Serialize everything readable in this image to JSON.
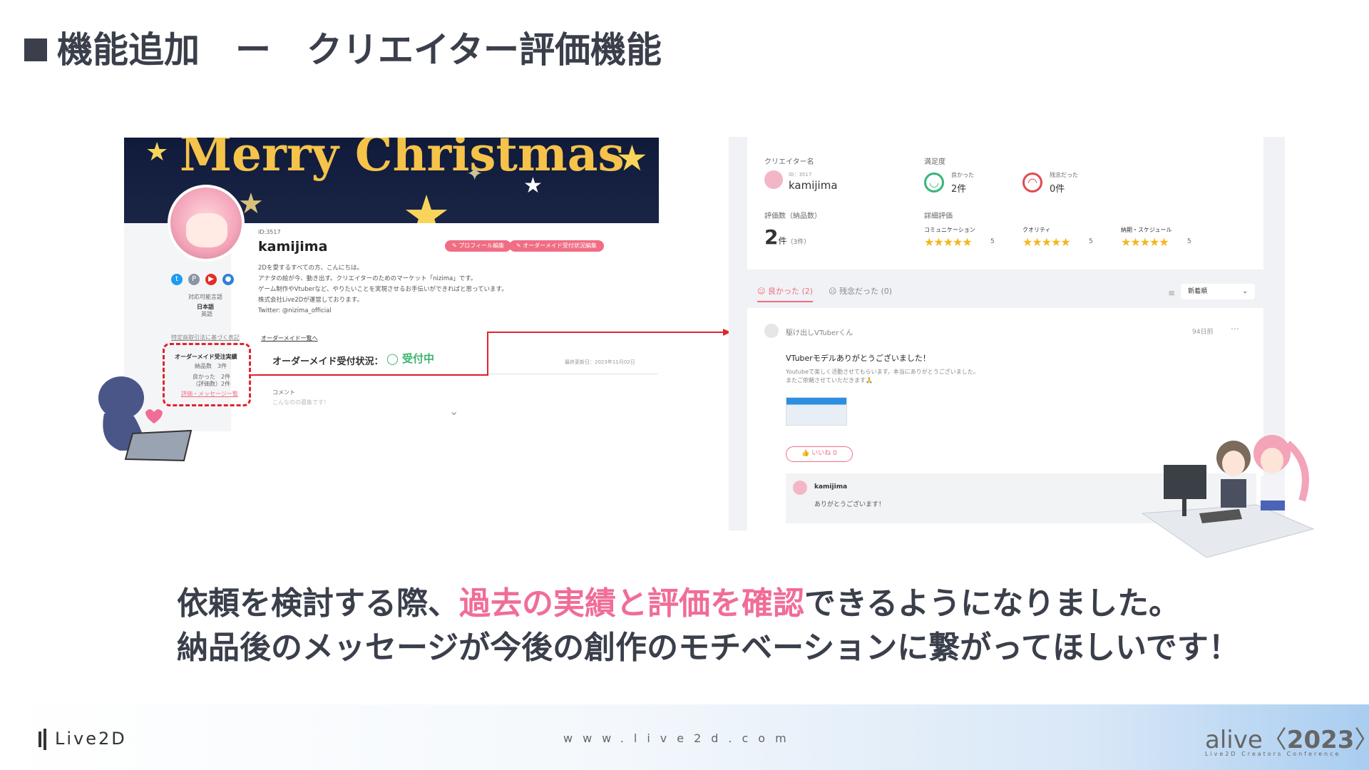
{
  "slide": {
    "title": "機能追加　ー　クリエイター評価機能",
    "subtitle_line1_a": "依頼を検討する際、",
    "subtitle_line1_highlight": "過去の実績と評価を確認",
    "subtitle_line1_b": "できるようになりました。",
    "subtitle_line2": "納品後のメッセージが今後の創作のモチベーションに繋がってほしいです！",
    "highlight_color": "#f06d97"
  },
  "left_screen": {
    "banner_text": "Merry Christmas",
    "creator_id": "ID:3517",
    "creator_name": "kamijima",
    "profile_edit_button": "プロフィール編集",
    "order_settings_button": "オーダーメイド受付状況編集",
    "bio_lines": [
      "2Dを愛するすべての方、こんにちは。",
      "アナタの絵が今、動き出す。クリエイターのためのマーケット「nizima」です。",
      "ゲーム制作やVtuberなど、やりたいことを実現させるお手伝いができればと思っています。",
      "株式会社Live2Dが運営しております。",
      "Twitter: @nizima_official"
    ],
    "languages_label": "対応可能言語",
    "languages": [
      "日本語",
      "英語"
    ],
    "legal_link": "特定商取引法に基づく表記",
    "order_list_link": "オーダーメイド一覧へ",
    "stats_title": "オーダーメイド受注実績",
    "stats_delivered": "納品数　3件",
    "stats_good": "良かった　2件",
    "stats_rated": "（評価数）2件",
    "stats_link": "評価・メッセージ一覧",
    "order_status_label": "オーダーメイド受付状況：",
    "order_status_value": "受付中",
    "last_updated": "最終更新日：2023年11月02日",
    "comment_label": "コメント",
    "comment_placeholder": "こんなのの募集です！"
  },
  "right_screen": {
    "creator_label": "クリエイター名",
    "creator_id": "ID：3517",
    "creator_name": "kamijima",
    "satisfaction_label": "満足度",
    "good_label": "良かった",
    "good_count": "2件",
    "bad_label": "残念だった",
    "bad_count": "0件",
    "rating_count_label": "評価数（納品数）",
    "rating_count": "2",
    "rating_unit": "件",
    "delivered_note": "（3件）",
    "detail_label": "詳細評価",
    "detail_items": [
      {
        "label": "コミュニケーション",
        "stars": 5,
        "value": "5"
      },
      {
        "label": "クオリティ",
        "stars": 5,
        "value": "5"
      },
      {
        "label": "納期・スケジュール",
        "stars": 5,
        "value": "5"
      }
    ],
    "tab_good": "良かった (2)",
    "tab_bad": "残念だった (0)",
    "sort_option": "新着順",
    "review_author": "駆け出しVTuberくん",
    "review_time": "94日前",
    "review_title": "VTuberモデルありがとうございました！",
    "review_body_1": "Youtubeで楽しく活動させてもらいます。本当にありがとうございました。",
    "review_body_2": "またご依頼させていただきます🙏",
    "like_button": "いいね 0",
    "reply_author": "kamijima",
    "reply_text": "ありがとうございます！"
  },
  "footer": {
    "logo": "Live2D",
    "url": "www.live2d.com",
    "event": "alive",
    "event_year": "2023",
    "event_sub": "Live2D Creators Conference"
  }
}
